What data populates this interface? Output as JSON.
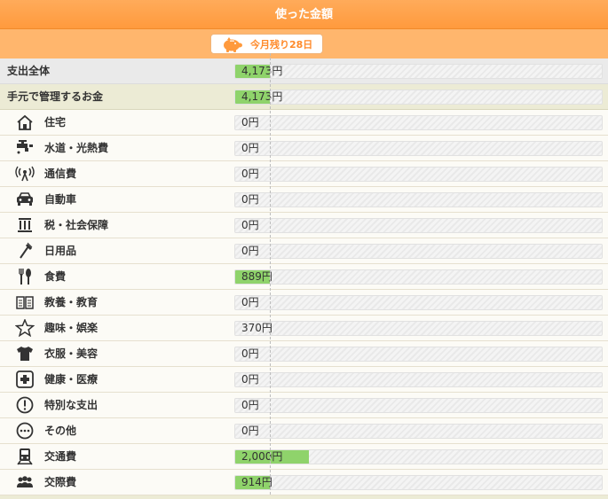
{
  "header": {
    "title": "使った金額"
  },
  "pill": {
    "text": "今月残り28日",
    "icon": "piggy-bank-icon"
  },
  "total": {
    "label": "支出全体",
    "value": "4,173円",
    "fraction": 0.094
  },
  "managed": {
    "label": "手元で管理するお金",
    "value": "4,173円",
    "fraction": 0.094
  },
  "categories": [
    {
      "label": "住宅",
      "icon": "house-icon",
      "value": "0円",
      "fraction": 0
    },
    {
      "label": "水道・光熱費",
      "icon": "faucet-icon",
      "value": "0円",
      "fraction": 0
    },
    {
      "label": "通信費",
      "icon": "antenna-icon",
      "value": "0円",
      "fraction": 0
    },
    {
      "label": "自動車",
      "icon": "car-icon",
      "value": "0円",
      "fraction": 0
    },
    {
      "label": "税・社会保障",
      "icon": "government-building-icon",
      "value": "0円",
      "fraction": 0
    },
    {
      "label": "日用品",
      "icon": "toothbrush-icon",
      "value": "0円",
      "fraction": 0
    },
    {
      "label": "食費",
      "icon": "fork-knife-icon",
      "value": "889円",
      "fraction": 0.094
    },
    {
      "label": "教養・教育",
      "icon": "open-book-icon",
      "value": "0円",
      "fraction": 0
    },
    {
      "label": "趣味・娯楽",
      "icon": "star-icon",
      "value": "370円",
      "fraction": 0
    },
    {
      "label": "衣服・美容",
      "icon": "tshirt-icon",
      "value": "0円",
      "fraction": 0
    },
    {
      "label": "健康・医療",
      "icon": "medical-cross-icon",
      "value": "0円",
      "fraction": 0
    },
    {
      "label": "特別な支出",
      "icon": "exclamation-icon",
      "value": "0円",
      "fraction": 0
    },
    {
      "label": "その他",
      "icon": "more-dots-icon",
      "value": "0円",
      "fraction": 0
    },
    {
      "label": "交通費",
      "icon": "train-icon",
      "value": "2,000円",
      "fraction": 0.2
    },
    {
      "label": "交際費",
      "icon": "people-icon",
      "value": "914円",
      "fraction": 0.094
    }
  ],
  "colors": {
    "header": "#ff9a3d",
    "bar_fill": "#8fd36b"
  }
}
